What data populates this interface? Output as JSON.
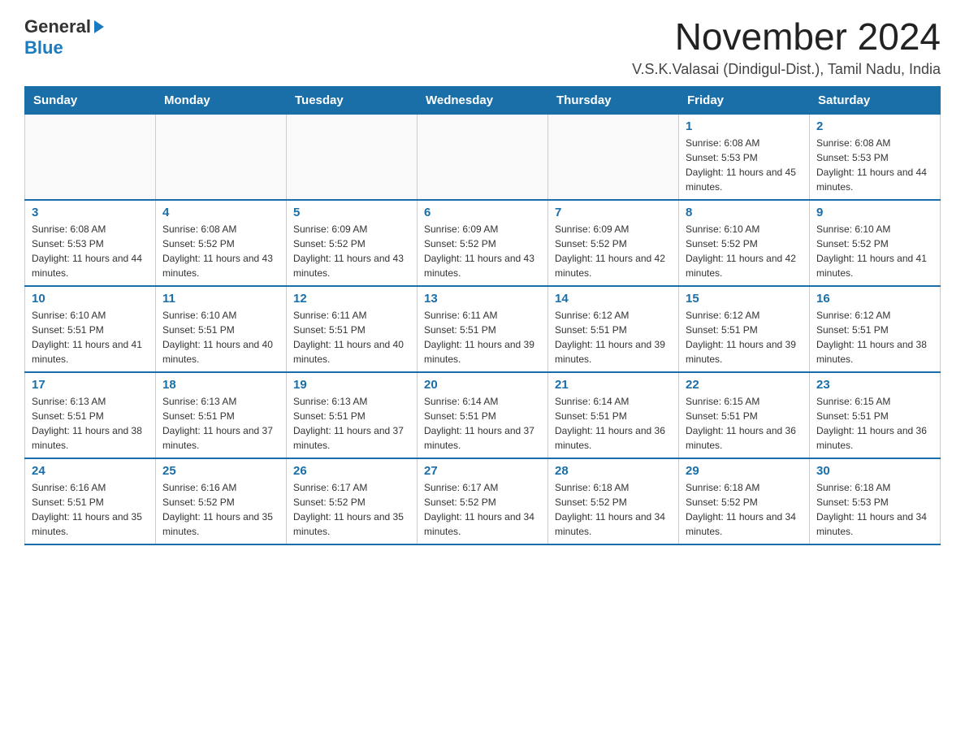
{
  "logo": {
    "general": "General",
    "blue": "Blue",
    "arrow": "▲"
  },
  "title": "November 2024",
  "subtitle": "V.S.K.Valasai (Dindigul-Dist.), Tamil Nadu, India",
  "days_of_week": [
    "Sunday",
    "Monday",
    "Tuesday",
    "Wednesday",
    "Thursday",
    "Friday",
    "Saturday"
  ],
  "weeks": [
    [
      {
        "num": "",
        "info": ""
      },
      {
        "num": "",
        "info": ""
      },
      {
        "num": "",
        "info": ""
      },
      {
        "num": "",
        "info": ""
      },
      {
        "num": "",
        "info": ""
      },
      {
        "num": "1",
        "info": "Sunrise: 6:08 AM\nSunset: 5:53 PM\nDaylight: 11 hours and 45 minutes."
      },
      {
        "num": "2",
        "info": "Sunrise: 6:08 AM\nSunset: 5:53 PM\nDaylight: 11 hours and 44 minutes."
      }
    ],
    [
      {
        "num": "3",
        "info": "Sunrise: 6:08 AM\nSunset: 5:53 PM\nDaylight: 11 hours and 44 minutes."
      },
      {
        "num": "4",
        "info": "Sunrise: 6:08 AM\nSunset: 5:52 PM\nDaylight: 11 hours and 43 minutes."
      },
      {
        "num": "5",
        "info": "Sunrise: 6:09 AM\nSunset: 5:52 PM\nDaylight: 11 hours and 43 minutes."
      },
      {
        "num": "6",
        "info": "Sunrise: 6:09 AM\nSunset: 5:52 PM\nDaylight: 11 hours and 43 minutes."
      },
      {
        "num": "7",
        "info": "Sunrise: 6:09 AM\nSunset: 5:52 PM\nDaylight: 11 hours and 42 minutes."
      },
      {
        "num": "8",
        "info": "Sunrise: 6:10 AM\nSunset: 5:52 PM\nDaylight: 11 hours and 42 minutes."
      },
      {
        "num": "9",
        "info": "Sunrise: 6:10 AM\nSunset: 5:52 PM\nDaylight: 11 hours and 41 minutes."
      }
    ],
    [
      {
        "num": "10",
        "info": "Sunrise: 6:10 AM\nSunset: 5:51 PM\nDaylight: 11 hours and 41 minutes."
      },
      {
        "num": "11",
        "info": "Sunrise: 6:10 AM\nSunset: 5:51 PM\nDaylight: 11 hours and 40 minutes."
      },
      {
        "num": "12",
        "info": "Sunrise: 6:11 AM\nSunset: 5:51 PM\nDaylight: 11 hours and 40 minutes."
      },
      {
        "num": "13",
        "info": "Sunrise: 6:11 AM\nSunset: 5:51 PM\nDaylight: 11 hours and 39 minutes."
      },
      {
        "num": "14",
        "info": "Sunrise: 6:12 AM\nSunset: 5:51 PM\nDaylight: 11 hours and 39 minutes."
      },
      {
        "num": "15",
        "info": "Sunrise: 6:12 AM\nSunset: 5:51 PM\nDaylight: 11 hours and 39 minutes."
      },
      {
        "num": "16",
        "info": "Sunrise: 6:12 AM\nSunset: 5:51 PM\nDaylight: 11 hours and 38 minutes."
      }
    ],
    [
      {
        "num": "17",
        "info": "Sunrise: 6:13 AM\nSunset: 5:51 PM\nDaylight: 11 hours and 38 minutes."
      },
      {
        "num": "18",
        "info": "Sunrise: 6:13 AM\nSunset: 5:51 PM\nDaylight: 11 hours and 37 minutes."
      },
      {
        "num": "19",
        "info": "Sunrise: 6:13 AM\nSunset: 5:51 PM\nDaylight: 11 hours and 37 minutes."
      },
      {
        "num": "20",
        "info": "Sunrise: 6:14 AM\nSunset: 5:51 PM\nDaylight: 11 hours and 37 minutes."
      },
      {
        "num": "21",
        "info": "Sunrise: 6:14 AM\nSunset: 5:51 PM\nDaylight: 11 hours and 36 minutes."
      },
      {
        "num": "22",
        "info": "Sunrise: 6:15 AM\nSunset: 5:51 PM\nDaylight: 11 hours and 36 minutes."
      },
      {
        "num": "23",
        "info": "Sunrise: 6:15 AM\nSunset: 5:51 PM\nDaylight: 11 hours and 36 minutes."
      }
    ],
    [
      {
        "num": "24",
        "info": "Sunrise: 6:16 AM\nSunset: 5:51 PM\nDaylight: 11 hours and 35 minutes."
      },
      {
        "num": "25",
        "info": "Sunrise: 6:16 AM\nSunset: 5:52 PM\nDaylight: 11 hours and 35 minutes."
      },
      {
        "num": "26",
        "info": "Sunrise: 6:17 AM\nSunset: 5:52 PM\nDaylight: 11 hours and 35 minutes."
      },
      {
        "num": "27",
        "info": "Sunrise: 6:17 AM\nSunset: 5:52 PM\nDaylight: 11 hours and 34 minutes."
      },
      {
        "num": "28",
        "info": "Sunrise: 6:18 AM\nSunset: 5:52 PM\nDaylight: 11 hours and 34 minutes."
      },
      {
        "num": "29",
        "info": "Sunrise: 6:18 AM\nSunset: 5:52 PM\nDaylight: 11 hours and 34 minutes."
      },
      {
        "num": "30",
        "info": "Sunrise: 6:18 AM\nSunset: 5:53 PM\nDaylight: 11 hours and 34 minutes."
      }
    ]
  ]
}
